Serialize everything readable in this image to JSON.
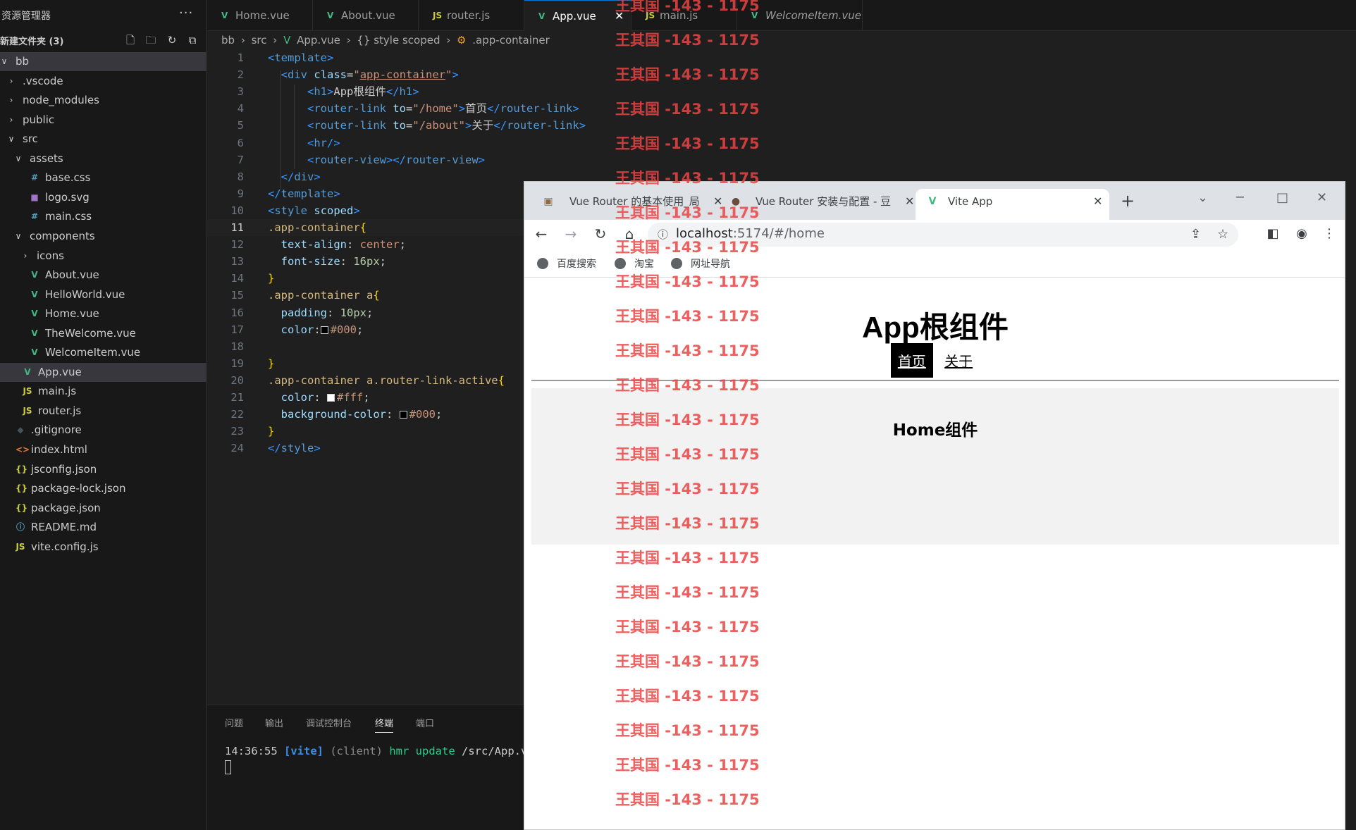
{
  "sidebar": {
    "title": "资源管理器",
    "more": "···",
    "folder": "新建文件夹 (3)",
    "tree": [
      {
        "label": "bb",
        "chev": "∨",
        "icon": "",
        "icon_color": ""
      },
      {
        "label": ".vscode",
        "chev": "›",
        "icon": "",
        "icon_color": ""
      },
      {
        "label": "node_modules",
        "chev": "›",
        "icon": "",
        "icon_color": ""
      },
      {
        "label": "public",
        "chev": "›",
        "icon": "",
        "icon_color": ""
      },
      {
        "label": "src",
        "chev": "∨",
        "icon": "",
        "icon_color": ""
      },
      {
        "label": "assets",
        "chev": "∨",
        "icon": "",
        "icon_color": ""
      },
      {
        "label": "base.css",
        "chev": "",
        "icon": "#",
        "icon_color": "#519aba"
      },
      {
        "label": "logo.svg",
        "chev": "",
        "icon": "■",
        "icon_color": "#a074c4"
      },
      {
        "label": "main.css",
        "chev": "",
        "icon": "#",
        "icon_color": "#519aba"
      },
      {
        "label": "components",
        "chev": "∨",
        "icon": "",
        "icon_color": ""
      },
      {
        "label": "icons",
        "chev": "›",
        "icon": "",
        "icon_color": ""
      },
      {
        "label": "About.vue",
        "chev": "",
        "icon": "V",
        "icon_color": "#41b883"
      },
      {
        "label": "HelloWorld.vue",
        "chev": "",
        "icon": "V",
        "icon_color": "#41b883"
      },
      {
        "label": "Home.vue",
        "chev": "",
        "icon": "V",
        "icon_color": "#41b883"
      },
      {
        "label": "TheWelcome.vue",
        "chev": "",
        "icon": "V",
        "icon_color": "#41b883"
      },
      {
        "label": "WelcomeItem.vue",
        "chev": "",
        "icon": "V",
        "icon_color": "#41b883"
      },
      {
        "label": "App.vue",
        "chev": "",
        "icon": "V",
        "icon_color": "#41b883"
      },
      {
        "label": "main.js",
        "chev": "",
        "icon": "JS",
        "icon_color": "#cbcb41"
      },
      {
        "label": "router.js",
        "chev": "",
        "icon": "JS",
        "icon_color": "#cbcb41"
      },
      {
        "label": ".gitignore",
        "chev": "",
        "icon": "◆",
        "icon_color": "#41535b"
      },
      {
        "label": "index.html",
        "chev": "",
        "icon": "<>",
        "icon_color": "#e37933"
      },
      {
        "label": "jsconfig.json",
        "chev": "",
        "icon": "{}",
        "icon_color": "#cbcb41"
      },
      {
        "label": "package-lock.json",
        "chev": "",
        "icon": "{}",
        "icon_color": "#cbcb41"
      },
      {
        "label": "package.json",
        "chev": "",
        "icon": "{}",
        "icon_color": "#cbcb41"
      },
      {
        "label": "README.md",
        "chev": "",
        "icon": "ⓘ",
        "icon_color": "#519aba"
      },
      {
        "label": "vite.config.js",
        "chev": "",
        "icon": "JS",
        "icon_color": "#cbcb41"
      }
    ]
  },
  "tabs": [
    {
      "label": "Home.vue",
      "icon": "V"
    },
    {
      "label": "About.vue",
      "icon": "V"
    },
    {
      "label": "router.js",
      "icon": "JS"
    },
    {
      "label": "App.vue",
      "icon": "V",
      "close": "✕"
    },
    {
      "label": "main.js",
      "icon": "JS"
    },
    {
      "label": "WelcomeItem.vue",
      "icon": "V"
    }
  ],
  "breadcrumb": {
    "bb": "bb",
    "sep": "›",
    "src": "src",
    "file": "App.vue",
    "style": "{} style scoped",
    "selector": ".app-container"
  },
  "editor": {
    "current_line": 11,
    "line_numbers": [
      "1",
      "2",
      "3",
      "4",
      "5",
      "6",
      "7",
      "8",
      "9",
      "10",
      "11",
      "12",
      "13",
      "14",
      "15",
      "16",
      "17",
      "18",
      "19",
      "20",
      "21",
      "22",
      "23",
      "24"
    ]
  },
  "panel": {
    "tabs": [
      "问题",
      "输出",
      "调试控制台",
      "终端",
      "端口"
    ],
    "active_tab": "终端",
    "terminal": {
      "time": "14:36:55",
      "tag": "[vite]",
      "client": "(client)",
      "msg": "hmr update",
      "path": "/src/App.vu"
    }
  },
  "browser": {
    "tabs": [
      {
        "title": "Vue Router 的基本使用_局",
        "close": "✕"
      },
      {
        "title": "Vue Router 安装与配置 - 豆",
        "close": "✕"
      },
      {
        "title": "Vite App",
        "close": "✕"
      }
    ],
    "new_tab": "+",
    "url_host": "localhost",
    "url_path": ":5174/#/home",
    "bookmarks": [
      "百度搜索",
      "淘宝",
      "网址导航"
    ],
    "page": {
      "title": "App根组件",
      "links": [
        "首页",
        "关于"
      ],
      "active_link": "首页",
      "home_text": "Home组件"
    }
  },
  "watermark": "王其国 -143 - 1175"
}
